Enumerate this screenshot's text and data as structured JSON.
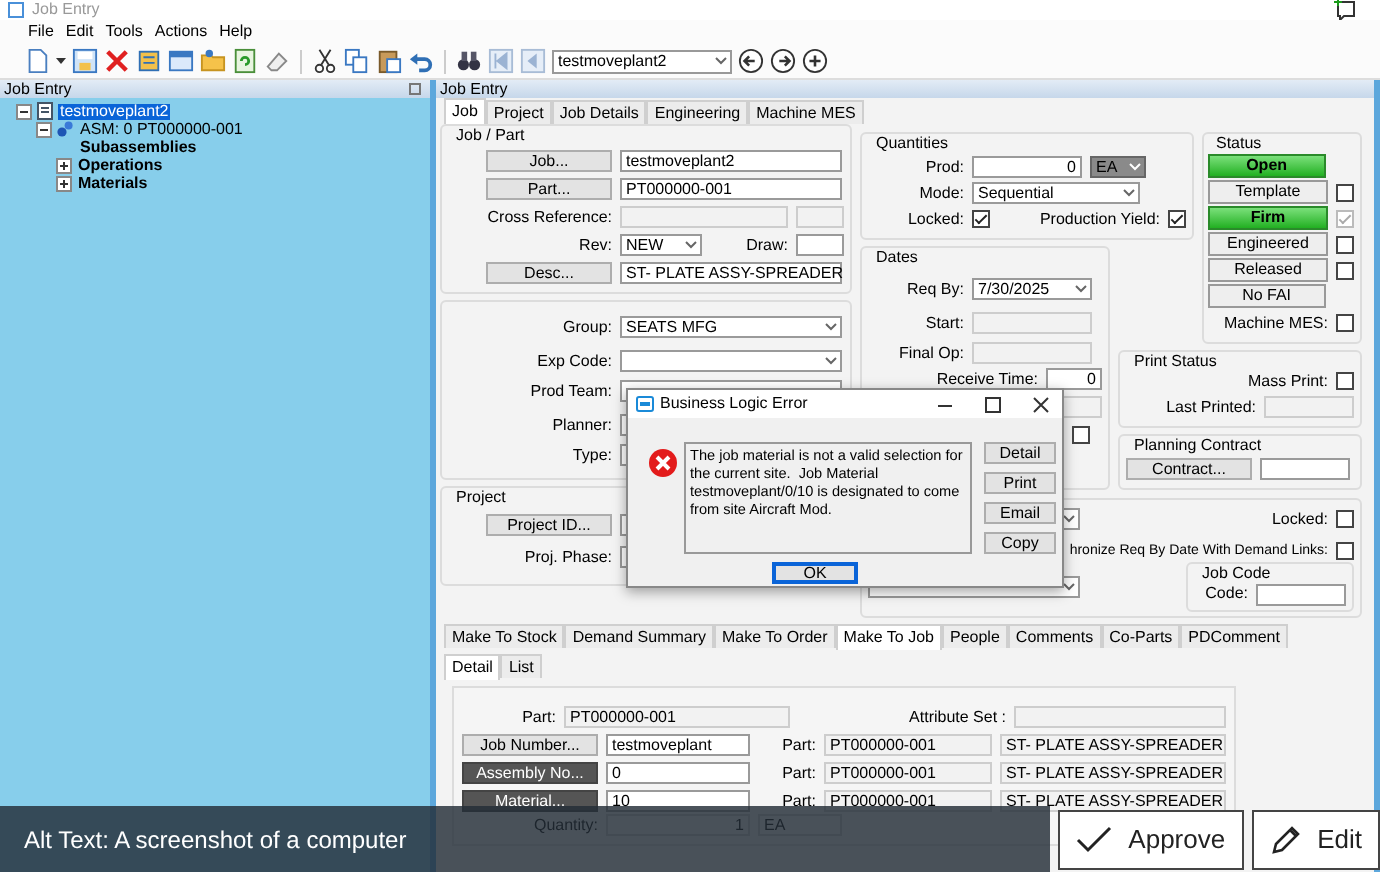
{
  "window": {
    "title": "Job Entry"
  },
  "menu": [
    "File",
    "Edit",
    "Tools",
    "Actions",
    "Help"
  ],
  "toolbar": {
    "record": "testmoveplant2"
  },
  "tree_panel": {
    "title": "Job Entry",
    "tree": [
      {
        "label": "testmoveplant2",
        "kind": "job",
        "selected": true,
        "expanded": true,
        "children": [
          {
            "label": "ASM: 0 PT000000-001",
            "kind": "assembly",
            "selected": false,
            "expanded": true,
            "children": [
              {
                "label": "Subassemblies",
                "kind": "group",
                "selected": false
              },
              {
                "label": "Operations",
                "kind": "group",
                "selected": false,
                "expanded": false
              },
              {
                "label": "Materials",
                "kind": "group",
                "selected": false,
                "expanded": false
              }
            ]
          }
        ]
      }
    ]
  },
  "main_panel": {
    "title": "Job Entry",
    "tabs": [
      {
        "label": "Job",
        "selected": true
      },
      {
        "label": "Project",
        "selected": false
      },
      {
        "label": "Job Details",
        "selected": false
      },
      {
        "label": "Engineering",
        "selected": false
      },
      {
        "label": "Machine MES",
        "selected": false
      }
    ]
  },
  "job_part": {
    "title": "Job / Part",
    "job_button": "Job...",
    "job": "testmoveplant2",
    "part_button": "Part...",
    "part": "PT000000-001",
    "cross_reference_label": "Cross Reference:",
    "rev_label": "Rev:",
    "rev": "NEW",
    "draw_label": "Draw:",
    "desc_button": "Desc...",
    "desc": "ST- PLATE ASSY-SPREADER"
  },
  "classification": {
    "group_label": "Group:",
    "group": "SEATS MFG",
    "exp_code_label": "Exp Code:",
    "prod_team_label": "Prod Team:",
    "planner_label": "Planner:",
    "type_label": "Type:"
  },
  "project": {
    "title": "Project",
    "project_id_button": "Project ID...",
    "proj_phase_label": "Proj. Phase:"
  },
  "quantities": {
    "title": "Quantities",
    "prod_label": "Prod:",
    "prod": "0",
    "uom": "EA",
    "mode_label": "Mode:",
    "mode": "Sequential",
    "locked_label": "Locked:",
    "locked": true,
    "production_yield_label": "Production Yield:",
    "production_yield": true
  },
  "dates": {
    "title": "Dates",
    "req_by_label": "Req By:",
    "req_by": "7/30/2025",
    "start_label": "Start:",
    "final_op_label": "Final Op:",
    "receive_time_label": "Receive Time:",
    "receive_time": "0",
    "checkbox_checked": false
  },
  "status": {
    "title": "Status",
    "items": [
      {
        "label": "Open",
        "kind": "plain",
        "active": true
      },
      {
        "label": "Template",
        "kind": "check",
        "active": false,
        "checked": false,
        "disabled": false
      },
      {
        "label": "Firm",
        "kind": "check",
        "active": true,
        "checked": true,
        "disabled": true
      },
      {
        "label": "Engineered",
        "kind": "check",
        "active": false,
        "checked": false,
        "disabled": false
      },
      {
        "label": "Released",
        "kind": "check",
        "active": false,
        "checked": false,
        "disabled": false
      },
      {
        "label": "No FAI",
        "kind": "plain",
        "active": false
      }
    ],
    "machine_mes_label": "Machine MES:",
    "machine_mes": false
  },
  "print_status": {
    "title": "Print Status",
    "mass_print_label": "Mass Print:",
    "mass_print": false,
    "last_printed_label": "Last Printed:"
  },
  "planning_contract": {
    "title": "Planning Contract",
    "contract_button": "Contract..."
  },
  "demand": {
    "locked_label": "Locked:",
    "locked": false,
    "synchronize_label": "hronize Req By Date With Demand Links:",
    "synchronize": false
  },
  "job_code": {
    "title": "Job Code",
    "code_label": "Code:"
  },
  "lower_tabs": [
    {
      "label": "Make To Stock",
      "selected": false
    },
    {
      "label": "Demand Summary",
      "selected": false
    },
    {
      "label": "Make To Order",
      "selected": false
    },
    {
      "label": "Make To Job",
      "selected": true
    },
    {
      "label": "People",
      "selected": false
    },
    {
      "label": "Comments",
      "selected": false
    },
    {
      "label": "Co-Parts",
      "selected": false
    },
    {
      "label": "PDComment",
      "selected": false
    }
  ],
  "detail_tabs": [
    {
      "label": "Detail",
      "selected": true
    },
    {
      "label": "List",
      "selected": false
    }
  ],
  "detail": {
    "part_label": "Part:",
    "part": "PT000000-001",
    "attribute_set_label": "Attribute Set :",
    "rows": [
      {
        "button": "Job Number...",
        "emphasized": false,
        "value": "testmoveplant",
        "part_label": "Part:",
        "part": "PT000000-001",
        "description": "ST- PLATE ASSY-SPREADER"
      },
      {
        "button": "Assembly No...",
        "emphasized": true,
        "value": "0",
        "part_label": "Part:",
        "part": "PT000000-001",
        "description": "ST- PLATE ASSY-SPREADER"
      },
      {
        "button": "Material...",
        "emphasized": true,
        "value": "10",
        "part_label": "Part:",
        "part": "PT000000-001",
        "description": "ST- PLATE ASSY-SPREADER"
      }
    ],
    "quantity_label": "Quantity:",
    "quantity": "1",
    "uom": "EA"
  },
  "dialog": {
    "title": "Business Logic Error",
    "message": "The job material is not a valid selection for the current site.  Job Material testmoveplant/0/10 is designated to come from site Aircraft Mod.",
    "buttons": [
      "Detail",
      "Print",
      "Email",
      "Copy"
    ],
    "ok": "OK"
  },
  "review_bar": {
    "alt_text": "Alt Text: A screenshot of a computer",
    "buttons": [
      {
        "label": "Approve",
        "kind": "approve"
      },
      {
        "label": "Edit",
        "kind": "edit"
      }
    ]
  }
}
